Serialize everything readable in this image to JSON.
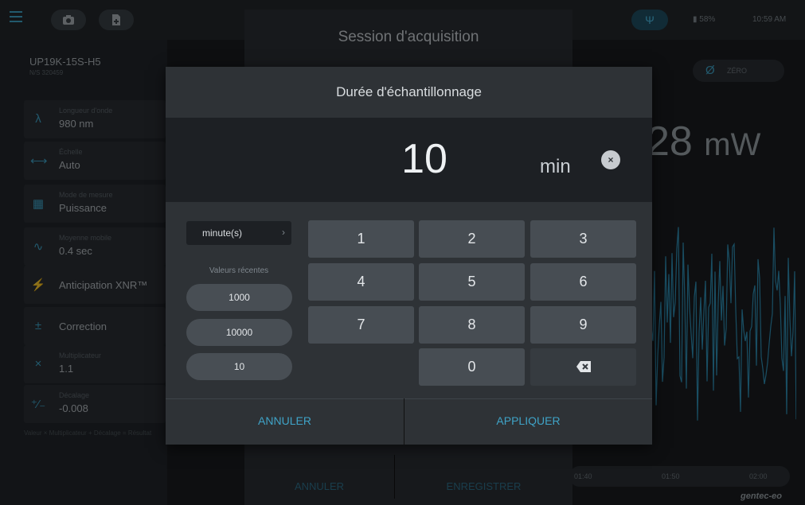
{
  "topbar": {
    "battery": "58%",
    "time": "10:59 AM"
  },
  "device": {
    "name": "UP19K-15S-H5",
    "serial": "N/S 320459"
  },
  "params": [
    {
      "label": "Longueur d'onde",
      "value": "980 nm",
      "icon": "lambda-icon"
    },
    {
      "label": "Échelle",
      "value": "Auto",
      "icon": "scale-icon"
    },
    {
      "label": "Mode de mesure",
      "value": "Puissance",
      "icon": "grid-icon"
    },
    {
      "label": "Moyenne mobile",
      "value": "0.4 sec",
      "icon": "wave-icon"
    },
    {
      "label": "Anticipation XNR™",
      "icon": "runner-icon"
    },
    {
      "label": "Correction",
      "icon": "plus-minus-icon"
    },
    {
      "label": "Multiplicateur",
      "value": "1.1",
      "icon": "multiply-icon"
    },
    {
      "label": "Décalage",
      "value": "-0.008",
      "icon": "offset-icon"
    }
  ],
  "formula": "Valeur × Multiplicateur + Décalage = Résultat",
  "zero": {
    "symbol": "Ø",
    "label": "ZÉRO"
  },
  "reading": {
    "value": "28",
    "unit": "mW"
  },
  "timeline": [
    "01:40",
    "01:50",
    "02:00"
  ],
  "brand": "gentec-eo",
  "session": {
    "title": "Session d'acquisition",
    "cancel": "ANNULER",
    "save": "ENREGISTRER"
  },
  "dialog": {
    "title": "Durée d'échantillonnage",
    "value": "10",
    "unit": "min",
    "clear": "×",
    "unit_select": "minute(s)",
    "recent_label": "Valeurs récentes",
    "recent": [
      "1000",
      "10000",
      "10"
    ],
    "keys": [
      "1",
      "2",
      "3",
      "4",
      "5",
      "6",
      "7",
      "8",
      "9",
      "0"
    ],
    "cancel": "ANNULER",
    "apply": "APPLIQUER"
  }
}
